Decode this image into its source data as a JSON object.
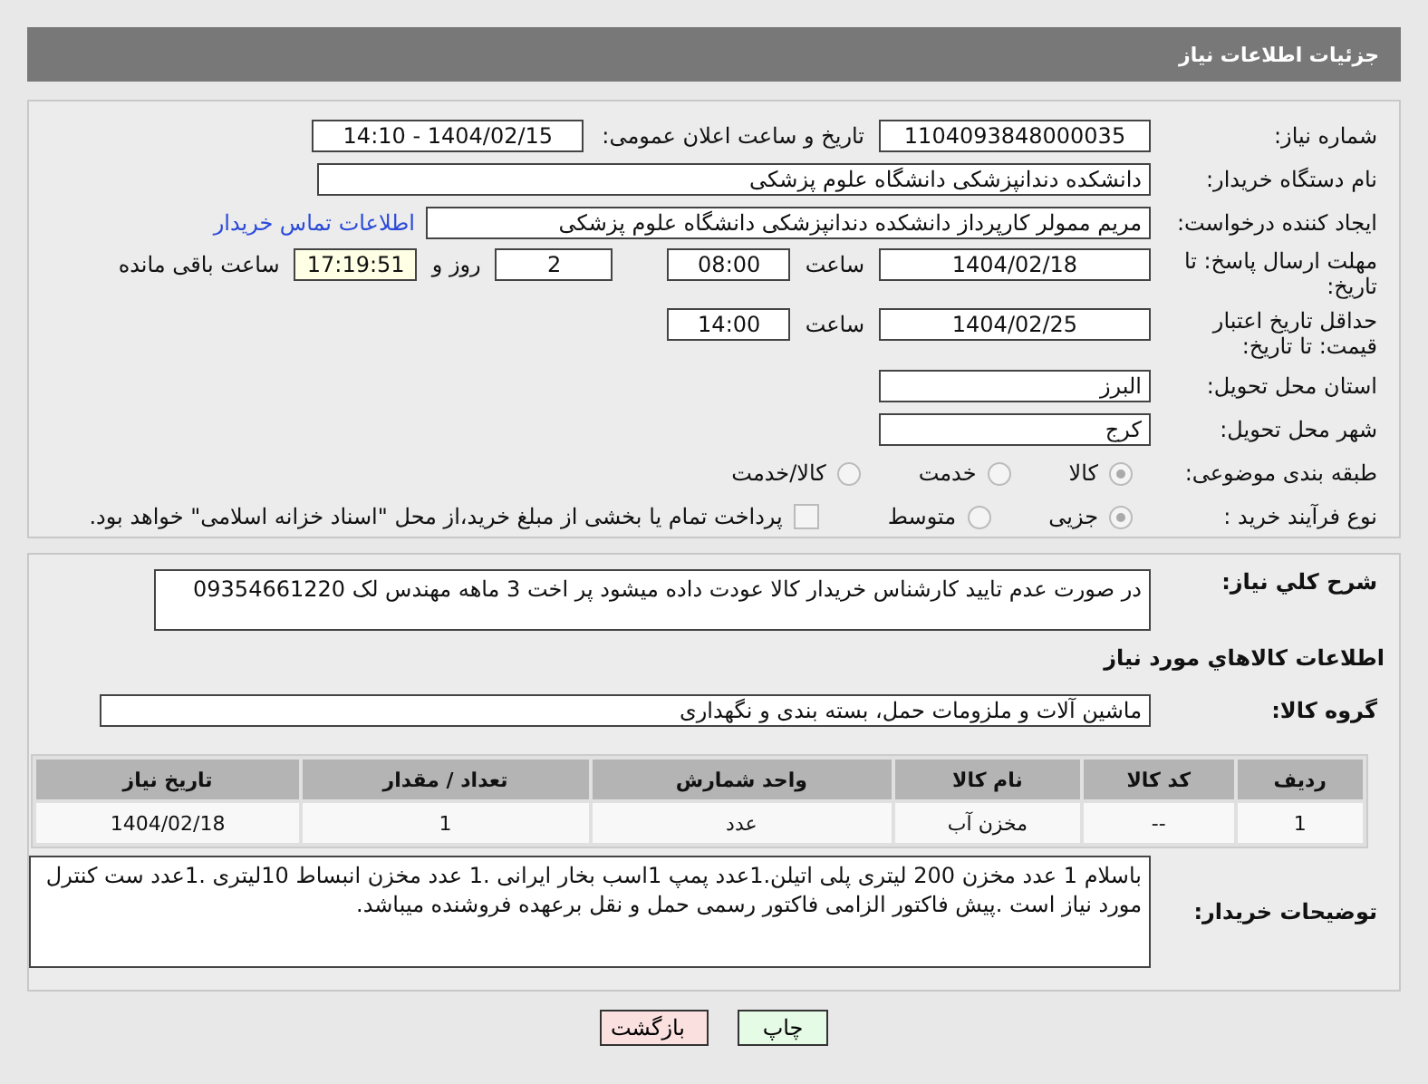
{
  "header": {
    "title": "جزئیات اطلاعات نیاز"
  },
  "need_number": {
    "label": "شماره نیاز:",
    "value": "1104093848000035"
  },
  "announce": {
    "label": "تاریخ و ساعت اعلان عمومی:",
    "value": "1404/02/15 - 14:10"
  },
  "buyer_org": {
    "label": "نام دستگاه خریدار:",
    "value": "دانشکده دندانپزشکی دانشگاه علوم پزشکی"
  },
  "requester": {
    "label": "ایجاد کننده درخواست:",
    "value": "مریم ممولر کارپرداز دانشکده دندانپزشکی دانشگاه علوم پزشکی",
    "link": "اطلاعات تماس خریدار"
  },
  "deadline": {
    "label": "مهلت ارسال پاسخ: تا تاریخ:",
    "date": "1404/02/18",
    "time_label": "ساعت",
    "time": "08:00",
    "days": "2",
    "days_label": "روز و",
    "remaining": "17:19:51",
    "remaining_label": "ساعت باقی مانده"
  },
  "validity": {
    "label": "حداقل تاریخ اعتبار قیمت: تا تاریخ:",
    "date": "1404/02/25",
    "time_label": "ساعت",
    "time": "14:00"
  },
  "province": {
    "label": "استان محل تحویل:",
    "value": "البرز"
  },
  "city": {
    "label": "شهر محل تحویل:",
    "value": "کرج"
  },
  "category": {
    "label": "طبقه بندی موضوعی:",
    "options": [
      {
        "label": "کالا",
        "selected": true
      },
      {
        "label": "خدمت",
        "selected": false
      },
      {
        "label": "کالا/خدمت",
        "selected": false
      }
    ]
  },
  "process": {
    "label": "نوع فرآیند خرید :",
    "options": [
      {
        "label": "جزیی",
        "selected": true
      },
      {
        "label": "متوسط",
        "selected": false
      }
    ],
    "payment": {
      "checked": false,
      "label": "پرداخت تمام یا بخشی از مبلغ خرید،از محل \"اسناد خزانه اسلامی\" خواهد بود."
    }
  },
  "description": {
    "label": "شرح کلي نياز:",
    "value": "در صورت عدم تایید کارشناس خریدار کالا عودت داده میشود پر اخت 3 ماهه مهندس لک 09354661220"
  },
  "goods_title": "اطلاعات کالاهاي مورد نياز",
  "goods_group": {
    "label": "گروه کالا:",
    "value": "ماشین آلات و ملزومات حمل، بسته بندی و نگهداری"
  },
  "table": {
    "columns": [
      "ردیف",
      "کد کالا",
      "نام کالا",
      "واحد شمارش",
      "تعداد / مقدار",
      "تاریخ نیاز"
    ],
    "rows": [
      [
        "1",
        "--",
        "مخزن آب",
        "عدد",
        "1",
        "1404/02/18"
      ]
    ]
  },
  "buyer_notes": {
    "label": "توضیحات خریدار:",
    "value": "باسلام 1 عدد مخزن 200 لیتری پلی اتیلن.1عدد پمپ 1اسب بخار ایرانی .1 عدد مخزن انبساط 10لیتری .1عدد ست کنترل مورد نیاز است .پیش فاکتور الزامی فاکتور رسمی حمل و نقل برعهده فروشنده میباشد."
  },
  "buttons": [
    {
      "label": "چاپ",
      "kind": "print"
    },
    {
      "label": "بازگشت",
      "kind": "back"
    }
  ]
}
